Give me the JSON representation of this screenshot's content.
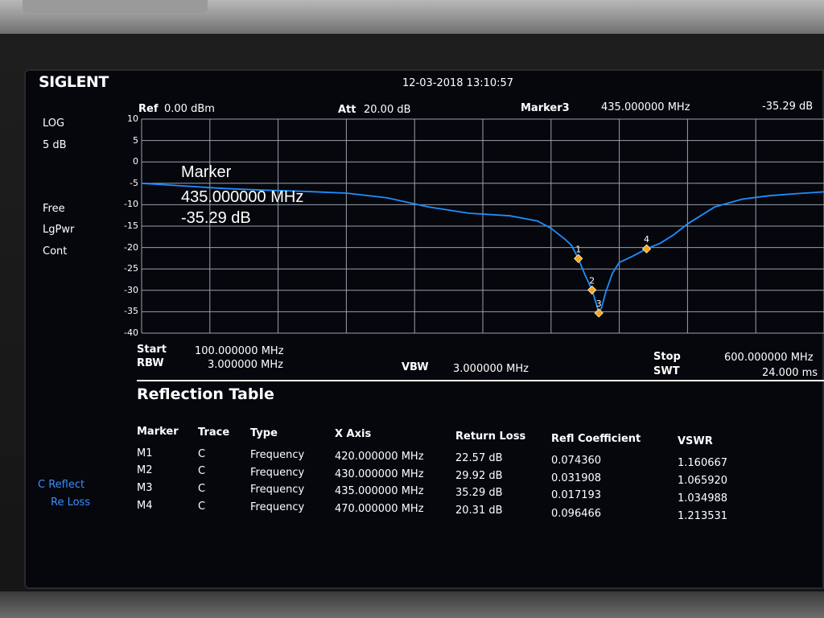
{
  "instrument": {
    "brand": "SIGLENT",
    "datetime": "12-03-2018  13:10:57"
  },
  "left_panel": {
    "scale_mode": "LOG",
    "scale_div": "5 dB",
    "detect_1": "Free",
    "detect_2": "LgPwr",
    "detect_3": "Cont",
    "menu_1": "C Reflect",
    "menu_2": "Re Loss"
  },
  "header": {
    "ref_label": "Ref",
    "ref_value": "0.00 dBm",
    "att_label": "Att",
    "att_value": "20.00 dB",
    "marker_label": "Marker3",
    "marker_freq": "435.000000 MHz",
    "marker_level": "-35.29 dB"
  },
  "plot_overlay": {
    "title": "Marker",
    "freq": "435.000000 MHz",
    "level": "-35.29 dB"
  },
  "footer": {
    "start_label": "Start",
    "start_value": "100.000000 MHz",
    "rbw_label": "RBW",
    "rbw_value": "3.000000 MHz",
    "vbw_label": "VBW",
    "vbw_value": "3.000000 MHz",
    "stop_label": "Stop",
    "stop_value": "600.000000 MHz",
    "swt_label": "SWT",
    "swt_value": "24.000 ms"
  },
  "colors": {
    "trace": "#1e8fff",
    "grid": "#9aa0ad",
    "marker": "#f5a623",
    "accent": "#3a8fff"
  },
  "chart_data": {
    "type": "line",
    "x_unit": "MHz",
    "y_unit": "dB",
    "xlim": [
      100,
      600
    ],
    "ylim": [
      -40,
      10
    ],
    "yticks": [
      10,
      5,
      0,
      -5,
      -10,
      -15,
      -20,
      -25,
      -30,
      -35,
      -40
    ],
    "grid": true,
    "series": [
      {
        "x": [
          100,
          130,
          160,
          190,
          220,
          250,
          280,
          310,
          340,
          370,
          390,
          400,
          410,
          415,
          420,
          425,
          430,
          433,
          435,
          437,
          440,
          445,
          450,
          460,
          470,
          480,
          490,
          500,
          520,
          540,
          560,
          580,
          600
        ],
        "y": [
          -5.0,
          -5.6,
          -6.2,
          -6.6,
          -6.9,
          -7.3,
          -8.4,
          -10.5,
          -12.0,
          -12.6,
          -13.8,
          -15.5,
          -18.0,
          -19.5,
          -22.57,
          -26.5,
          -29.92,
          -33.0,
          -35.29,
          -34.0,
          -30.5,
          -26.0,
          -23.5,
          -22.0,
          -20.31,
          -19.0,
          -17.0,
          -14.5,
          -10.5,
          -8.7,
          -7.9,
          -7.4,
          -7.0
        ]
      }
    ],
    "markers": [
      {
        "label": "1",
        "x": 420,
        "y": -22.57
      },
      {
        "label": "2",
        "x": 430,
        "y": -29.92
      },
      {
        "label": "3",
        "x": 435,
        "y": -35.29
      },
      {
        "label": "4",
        "x": 470,
        "y": -20.31
      }
    ]
  },
  "table": {
    "title": "Reflection Table",
    "headers": [
      "Marker",
      "Trace",
      "Type",
      "X Axis",
      "Return Loss",
      "Refl Coefficient",
      "VSWR"
    ],
    "rows": [
      [
        "M1",
        "C",
        "Frequency",
        "420.000000 MHz",
        "22.57 dB",
        "0.074360",
        "1.160667"
      ],
      [
        "M2",
        "C",
        "Frequency",
        "430.000000 MHz",
        "29.92 dB",
        "0.031908",
        "1.065920"
      ],
      [
        "M3",
        "C",
        "Frequency",
        "435.000000 MHz",
        "35.29 dB",
        "0.017193",
        "1.034988"
      ],
      [
        "M4",
        "C",
        "Frequency",
        "470.000000 MHz",
        "20.31 dB",
        "0.096466",
        "1.213531"
      ]
    ]
  }
}
